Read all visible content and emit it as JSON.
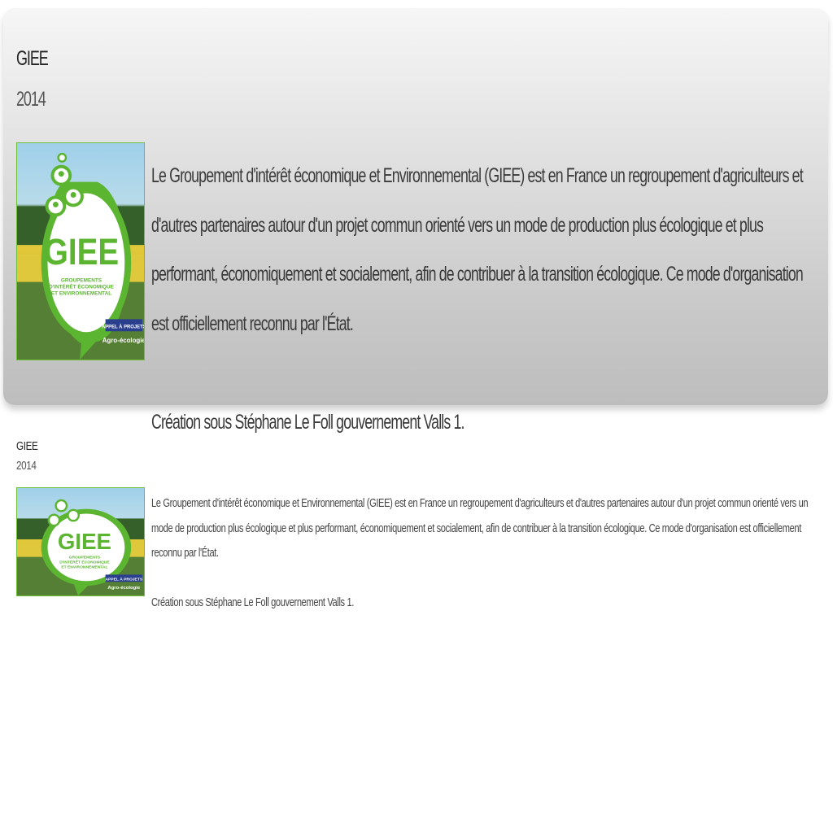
{
  "featured": {
    "title": "GIEE",
    "year": "2014",
    "description": "Le Groupement d'intérêt économique et Environnemental (GIEE) est en France un regroupement d'agriculteurs et d'autres partenaires autour d'un projet commun orienté vers un mode de production plus écologique et plus performant, économiquement et socialement, afin de contribuer à la transition écologique. Ce mode d'organisation est officiellement reconnu par l'État.",
    "note": "Création sous Stéphane Le Foll gouvernement Valls 1."
  },
  "item": {
    "title": "GIEE",
    "year": "2014",
    "description": "Le Groupement d'intérêt économique et Environnemental (GIEE) est en France un regroupement d'agriculteurs et d'autres partenaires autour d'un projet commun orienté vers un mode de production plus écologique et plus performant, économiquement et socialement, afin de contribuer à la transition écologique. Ce mode d'organisation est officiellement reconnu par l'État.",
    "note": "Création sous Stéphane Le Foll gouvernement Valls 1."
  },
  "logo": {
    "acronym": "GIEE",
    "line1": "GROUPEMENTS",
    "line2": "D'INTÉRÊT ÉCONOMIQUE",
    "line3": "ET ENVIRONNEMENTAL",
    "badge": "APPEL À PROJETS",
    "tagline": "Agro-écologie"
  },
  "colors": {
    "logo_green": "#5cb531",
    "badge_blue": "#2b3f8f"
  }
}
